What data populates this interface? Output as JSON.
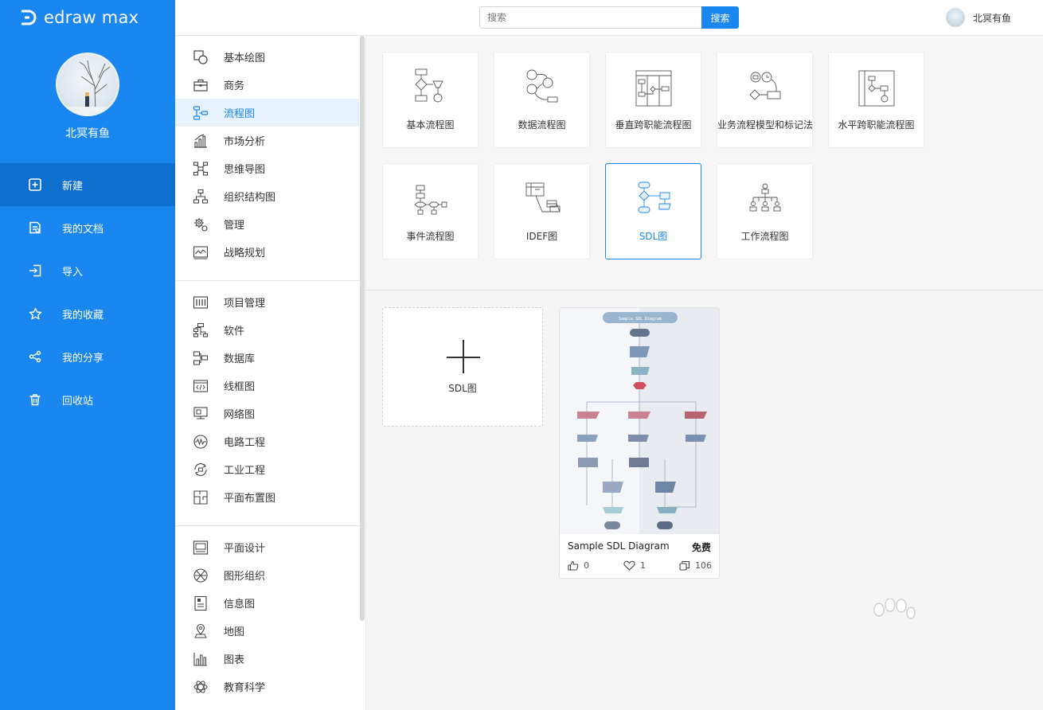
{
  "app": {
    "name": "edraw max"
  },
  "profile": {
    "name": "北冥有鱼"
  },
  "nav": {
    "items": [
      {
        "label": "新建",
        "icon": "plus-square-icon"
      },
      {
        "label": "我的文档",
        "icon": "documents-icon"
      },
      {
        "label": "导入",
        "icon": "import-icon"
      },
      {
        "label": "我的收藏",
        "icon": "star-icon"
      },
      {
        "label": "我的分享",
        "icon": "share-icon"
      },
      {
        "label": "回收站",
        "icon": "trash-icon"
      }
    ],
    "active": "新建"
  },
  "search": {
    "placeholder": "搜索",
    "button": "搜索"
  },
  "topbar": {
    "user_name": "北冥有鱼"
  },
  "categories": {
    "group1": [
      "基本绘图",
      "商务",
      "流程图",
      "市场分析",
      "思维导图",
      "组织结构图",
      "管理",
      "战略规划"
    ],
    "group2": [
      "项目管理",
      "软件",
      "数据库",
      "线框图",
      "网络图",
      "电路工程",
      "工业工程",
      "平面布置图"
    ],
    "group3": [
      "平面设计",
      "图形组织",
      "信息图",
      "地图",
      "图表",
      "教育科学"
    ],
    "active": "流程图"
  },
  "subtypes": [
    {
      "label": "基本流程图"
    },
    {
      "label": "数据流程图"
    },
    {
      "label": "垂直跨职能流程图"
    },
    {
      "label": "业务流程模型和标记法"
    },
    {
      "label": "水平跨职能流程图"
    },
    {
      "label": "事件流程图"
    },
    {
      "label": "IDEF图"
    },
    {
      "label": "SDL图"
    },
    {
      "label": "工作流程图"
    }
  ],
  "active_subtype": "SDL图",
  "new_card": {
    "label": "SDL图"
  },
  "template": {
    "title": "Sample SDL Diagram",
    "badge": "免费",
    "likes": "0",
    "favorites": "1",
    "copies": "106",
    "image_title": "Sample SDL Diagram"
  },
  "colors": {
    "accent": "#1a86ef",
    "sidebar": "#1a86ef",
    "active_nav": "#0f6fcf"
  }
}
